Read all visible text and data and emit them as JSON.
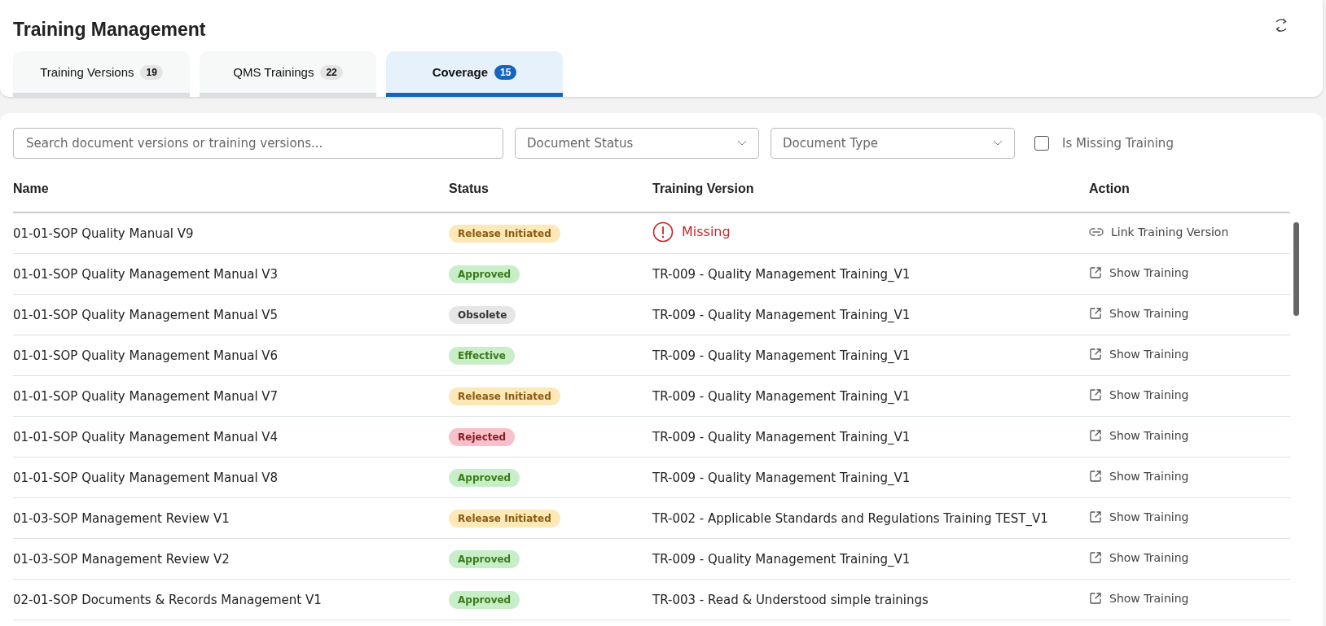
{
  "header": {
    "title": "Training Management"
  },
  "tabs": [
    {
      "label": "Training Versions",
      "count": "19",
      "selected": false
    },
    {
      "label": "QMS Trainings",
      "count": "22",
      "selected": false
    },
    {
      "label": "Coverage",
      "count": "15",
      "selected": true
    }
  ],
  "filters": {
    "search": {
      "placeholder": "Search document versions or training versions..."
    },
    "status": {
      "placeholder": "Document Status"
    },
    "type": {
      "placeholder": "Document Type"
    },
    "missing": {
      "label": "Is Missing Training",
      "checked": false
    }
  },
  "table": {
    "columns": [
      "Name",
      "Status",
      "Training Version",
      "Action"
    ],
    "rows": [
      {
        "name": "01-01-SOP Quality Manual V9",
        "status": {
          "label": "Release Initiated",
          "kind": "release"
        },
        "training": {
          "kind": "missing",
          "text": "Missing"
        },
        "action": {
          "kind": "link",
          "label": "Link Training Version"
        }
      },
      {
        "name": "01-01-SOP Quality Management Manual V3",
        "status": {
          "label": "Approved",
          "kind": "approved"
        },
        "training": {
          "kind": "linked",
          "text": "TR-009 - Quality Management Training_V1"
        },
        "action": {
          "kind": "show",
          "label": "Show Training"
        }
      },
      {
        "name": "01-01-SOP Quality Management Manual V5",
        "status": {
          "label": "Obsolete",
          "kind": "obsolete"
        },
        "training": {
          "kind": "linked",
          "text": "TR-009 - Quality Management Training_V1"
        },
        "action": {
          "kind": "show",
          "label": "Show Training"
        }
      },
      {
        "name": "01-01-SOP Quality Management Manual V6",
        "status": {
          "label": "Effective",
          "kind": "effective"
        },
        "training": {
          "kind": "linked",
          "text": "TR-009 - Quality Management Training_V1"
        },
        "action": {
          "kind": "show",
          "label": "Show Training"
        }
      },
      {
        "name": "01-01-SOP Quality Management Manual V7",
        "status": {
          "label": "Release Initiated",
          "kind": "release"
        },
        "training": {
          "kind": "linked",
          "text": "TR-009 - Quality Management Training_V1"
        },
        "action": {
          "kind": "show",
          "label": "Show Training"
        }
      },
      {
        "name": "01-01-SOP Quality Management Manual V4",
        "status": {
          "label": "Rejected",
          "kind": "rejected"
        },
        "training": {
          "kind": "linked",
          "text": "TR-009 - Quality Management Training_V1"
        },
        "action": {
          "kind": "show",
          "label": "Show Training"
        }
      },
      {
        "name": "01-01-SOP Quality Management Manual V8",
        "status": {
          "label": "Approved",
          "kind": "approved"
        },
        "training": {
          "kind": "linked",
          "text": "TR-009 - Quality Management Training_V1"
        },
        "action": {
          "kind": "show",
          "label": "Show Training"
        }
      },
      {
        "name": "01-03-SOP Management Review V1",
        "status": {
          "label": "Release Initiated",
          "kind": "release"
        },
        "training": {
          "kind": "linked",
          "text": "TR-002 - Applicable Standards and Regulations Training TEST_V1"
        },
        "action": {
          "kind": "show",
          "label": "Show Training"
        }
      },
      {
        "name": "01-03-SOP Management Review V2",
        "status": {
          "label": "Approved",
          "kind": "approved"
        },
        "training": {
          "kind": "linked",
          "text": "TR-009 - Quality Management Training_V1"
        },
        "action": {
          "kind": "show",
          "label": "Show Training"
        }
      },
      {
        "name": "02-01-SOP Documents & Records Management V1",
        "status": {
          "label": "Approved",
          "kind": "approved"
        },
        "training": {
          "kind": "linked",
          "text": "TR-003 - Read & Understood simple trainings"
        },
        "action": {
          "kind": "show",
          "label": "Show Training"
        }
      }
    ]
  }
}
